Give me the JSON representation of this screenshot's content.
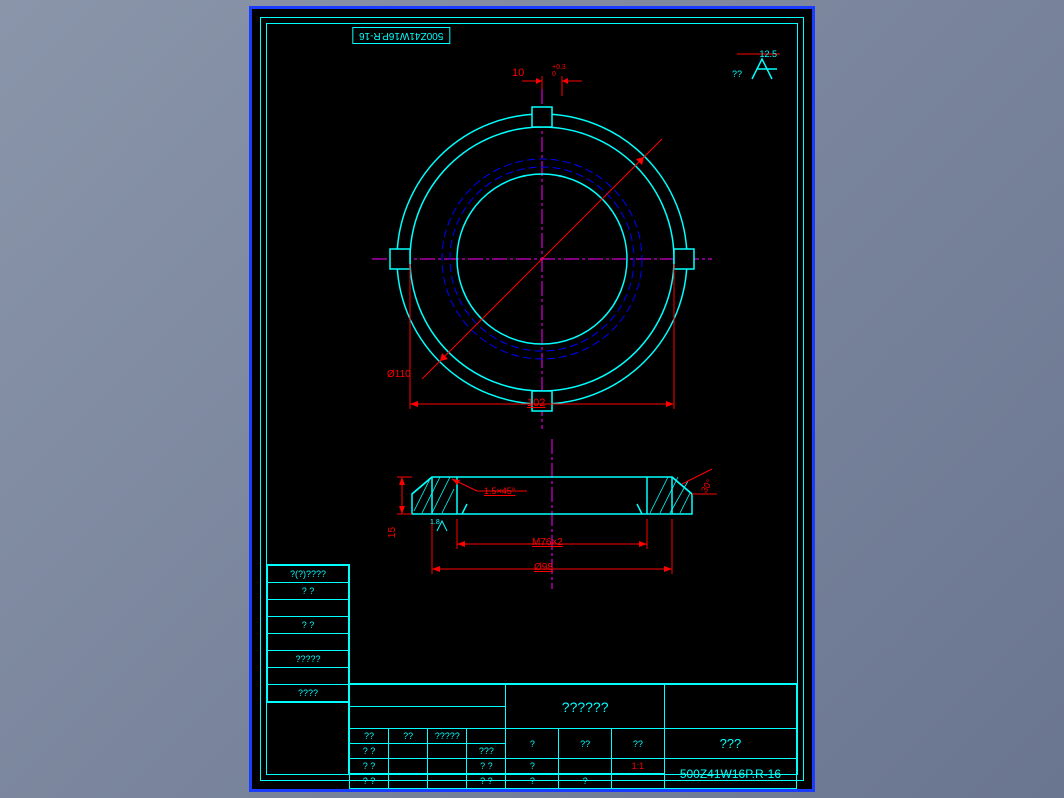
{
  "part_number": "500Z41W16P.R-16",
  "part_number_rot": "500Z41W16P.R-16",
  "dims": {
    "slot_width": "10",
    "slot_tol": "+0.3\n0",
    "outer_dia": "Ø110",
    "slot_dia": "102",
    "chamfer": "1.5×45°",
    "height": "15",
    "thread": "M76×2",
    "inner_dia": "Ø98",
    "angle": "30°",
    "surf_small": "1.8"
  },
  "surface": {
    "value": "12.5",
    "other": "??"
  },
  "title": "??????",
  "company": "???",
  "scale": "1:1",
  "left_labels": {
    "l1": "?(?)????",
    "l2": "?  ?",
    "l3": "?  ?",
    "l4": "?????",
    "l5": "????"
  },
  "tb": {
    "r1c1": "??",
    "r1c2": "??",
    "r1c3": "?????",
    "r1c4": "",
    "r1c5": "",
    "r1c6": "",
    "r1c7": "",
    "r2c1": "? ?",
    "r2c2": "",
    "r2c3": "",
    "r2c4": "???",
    "r2c5": "",
    "r2c6": "",
    "r2c7": "",
    "r3c1": "? ?",
    "r3c2": "",
    "r3c3": "",
    "r3c4": "? ?",
    "r3c5": "",
    "r3c6": "",
    "r3c7": "",
    "r4c1": "? ?",
    "r4c2": "",
    "r4c3": "",
    "r4c4": "? ?",
    "r4c5": "",
    "r4c6": "",
    "r4c7": "",
    "m1": "?",
    "m2": "?",
    "m3": "?",
    "m4": "?",
    "m5": "??",
    "m6": "??",
    "b1": "?",
    "b2": "?",
    "b3": "",
    "b4": "?",
    "b5": "?"
  }
}
